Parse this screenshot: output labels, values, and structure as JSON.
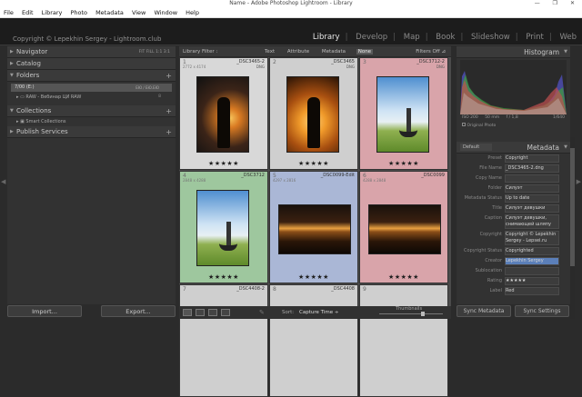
{
  "window": {
    "title": "Name - Adobe Photoshop Lightroom - Library",
    "controls": "— ❐ ✕"
  },
  "menu": [
    "File",
    "Edit",
    "Library",
    "Photo",
    "Metadata",
    "View",
    "Window",
    "Help"
  ],
  "identity": {
    "text": "Copyright © Lepekhin Sergey - Lightroom.club"
  },
  "modules": [
    "Library",
    "Develop",
    "Map",
    "Book",
    "Slideshow",
    "Print",
    "Web"
  ],
  "module_active": "Library",
  "left": {
    "navigator": {
      "label": "Navigator",
      "options": "FIT  FILL  1:1  3:1"
    },
    "catalog": {
      "label": "Catalog"
    },
    "folders": {
      "label": "Folders",
      "drive": "7/00 (E:)",
      "drive_info": "ЕЮ / ЕЮ.ЕЮ",
      "folder": "RAW - Вебинар ЦИ RAW",
      "folder_count": "8"
    },
    "collections": {
      "label": "Collections",
      "smart": "Smart Collections"
    },
    "publish": {
      "label": "Publish Services"
    },
    "import_label": "Import...",
    "export_label": "Export..."
  },
  "filter": {
    "label": "Library Filter :",
    "options": [
      "Text",
      "Attribute",
      "Metadata",
      "None"
    ],
    "selected": "None",
    "filters_off": "Filters Off ⊿"
  },
  "grid": [
    {
      "num": "1",
      "name": "_DSC3465-2",
      "dims": "2772 x 4174",
      "ext": "DNG",
      "stars": "★★★★★",
      "bg": "#d8d8d8",
      "photo": "silhouette-sunset"
    },
    {
      "num": "2",
      "name": "_DSC3465",
      "dims": "",
      "ext": "DNG",
      "stars": "★★★★★",
      "bg": "#cfcfcf",
      "photo": "silhouette-golden"
    },
    {
      "num": "3",
      "name": "_DSC3712-2",
      "dims": "",
      "ext": "DNG",
      "stars": "★★★★★",
      "bg": "#d9a4aa",
      "photo": "cyclist-sky"
    },
    {
      "num": "4",
      "name": "_DSC3712",
      "dims": "2848 x 4288",
      "ext": "",
      "stars": "★★★★★",
      "bg": "#9ec79e",
      "photo": "cyclist-sky"
    },
    {
      "num": "5",
      "name": "_DSC0099-Edit",
      "dims": "4297 x 2816",
      "ext": "",
      "stars": "★★★★★",
      "bg": "#aab7d6",
      "photo": "kremlin-night"
    },
    {
      "num": "6",
      "name": "_DSC0099",
      "dims": "4288 x 2848",
      "ext": "",
      "stars": "★★★★★",
      "bg": "#d9a4aa",
      "photo": "kremlin-night"
    },
    {
      "num": "7",
      "name": "_DSC4408-2",
      "dims": "",
      "ext": "",
      "stars": "",
      "bg": "#cfcfcf",
      "photo": ""
    },
    {
      "num": "8",
      "name": "_DSC4408",
      "dims": "",
      "ext": "",
      "stars": "",
      "bg": "#cfcfcf",
      "photo": ""
    },
    {
      "num": "9",
      "name": "",
      "dims": "",
      "ext": "",
      "stars": "",
      "bg": "#cfcfcf",
      "photo": ""
    }
  ],
  "toolbar": {
    "sort_label": "Sort:",
    "sort_value": "Capture Time ÷",
    "thumbs_label": "Thumbnails"
  },
  "right": {
    "histogram": {
      "label": "Histogram",
      "iso": "ISO 200",
      "focal": "50 mm",
      "fstop": "f / 1,8",
      "shutter": "1/640",
      "original": "Original Photo"
    },
    "metadata": {
      "label": "Metadata",
      "preset_default": "Default",
      "rows": [
        {
          "k": "Preset",
          "v": "Copyright"
        },
        {
          "k": "File Name",
          "v": "_DSC3465-2.dng"
        },
        {
          "k": "Copy Name",
          "v": ""
        },
        {
          "k": "Folder",
          "v": "Силуэт"
        },
        {
          "k": "Metadata Status",
          "v": "Up to date"
        },
        {
          "k": "Title",
          "v": "Силуэт девушки"
        },
        {
          "k": "Caption",
          "v": "Силуэт девушки, снимающей шляпу"
        },
        {
          "k": "Copyright",
          "v": "Copyright © Lepekhin Sergey - Lepsei.ru"
        },
        {
          "k": "Copyright Status",
          "v": "Copyrighted"
        },
        {
          "k": "Creator",
          "v": "Lepekhin Sergey"
        },
        {
          "k": "Sublocation",
          "v": ""
        },
        {
          "k": "Rating",
          "v": "★★★★★"
        },
        {
          "k": "Label",
          "v": "Red"
        }
      ]
    },
    "sync_metadata": "Sync Metadata",
    "sync_settings": "Sync Settings"
  },
  "colors": {
    "bg": "#2b2b2b",
    "panel": "#323232",
    "grid_bg": "#4b4b4b",
    "accent": "#e6e6e6",
    "creator_highlight": "#5b7fb9"
  }
}
